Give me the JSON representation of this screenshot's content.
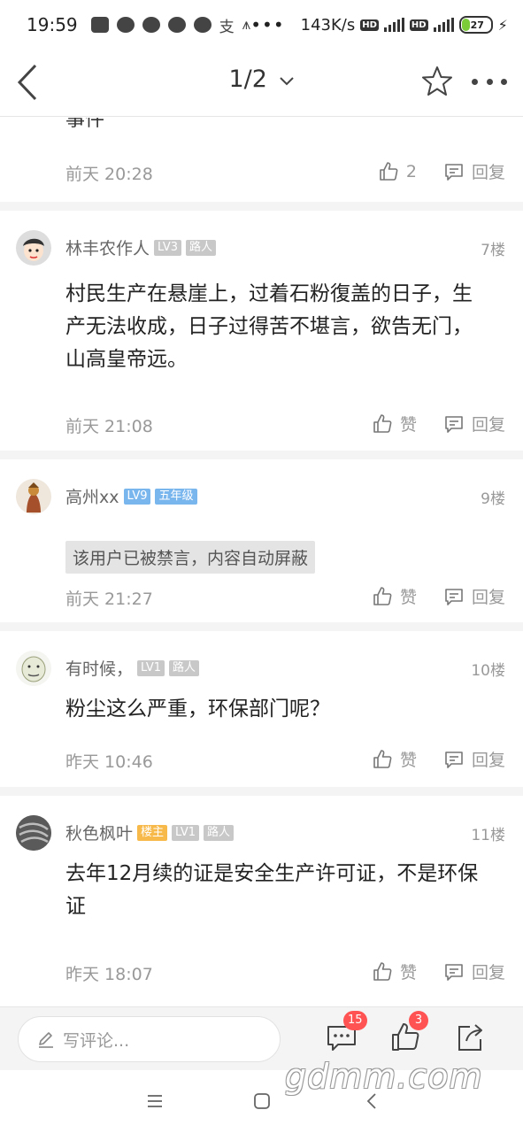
{
  "status_bar": {
    "time": "19:59",
    "dots": "•••",
    "speed": "143K/s",
    "hd": "HD",
    "battery": "27"
  },
  "nav": {
    "page_indicator": "1/2"
  },
  "partial_comment": {
    "cut_text": "事件",
    "time": "前天 20:28",
    "like_count": "2",
    "reply_label": "回复"
  },
  "posts": [
    {
      "user": "林丰农作人",
      "tags": [
        "LV3",
        "路人"
      ],
      "floor": "7楼",
      "text": "村民生产在悬崖上，过着石粉復盖的日子，生产无法收成，日子过得苦不堪言，欲告无门，山高皇帝远。",
      "time": "前天 21:08",
      "like_label": "赞",
      "reply_label": "回复"
    },
    {
      "user": "高州xx",
      "tags": [
        "LV9",
        "五年级"
      ],
      "floor": "9楼",
      "banned_text": "该用户已被禁言，内容自动屏蔽",
      "time": "前天 21:27",
      "like_label": "赞",
      "reply_label": "回复"
    },
    {
      "user": "有时候，",
      "tags": [
        "LV1",
        "路人"
      ],
      "floor": "10楼",
      "text": "粉尘这么严重，环保部门呢？",
      "time": "昨天 10:46",
      "like_label": "赞",
      "reply_label": "回复"
    },
    {
      "user": "秋色枫叶",
      "tags": [
        "楼主",
        "LV1",
        "路人"
      ],
      "floor": "11楼",
      "text": "去年12月续的证是安全生产许可证，不是环保证",
      "time": "昨天 18:07",
      "like_label": "赞",
      "reply_label": "回复"
    }
  ],
  "bottom_bar": {
    "input_placeholder": "写评论...",
    "comment_badge": "15",
    "like_badge": "3"
  },
  "watermark": "gdmm.com",
  "colors": {
    "tag_gray": "#c8c8c8",
    "tag_blue": "#7ab6ee",
    "tag_orange": "#f7b94a",
    "badge_red": "#ff5252"
  }
}
